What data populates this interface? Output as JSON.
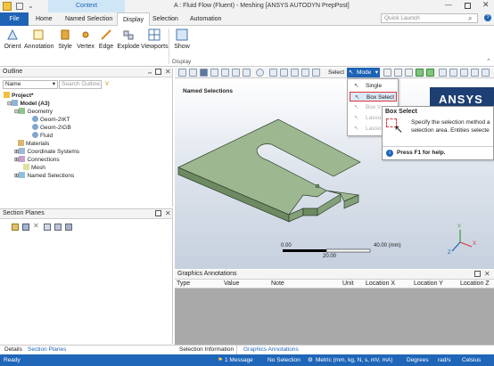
{
  "titlebar": {
    "context": "Context",
    "title": "A : Fluid Flow (Fluent) - Meshing [ANSYS AUTODYN PrepPost]"
  },
  "search": {
    "placeholder": "Quick Launch"
  },
  "tabs": [
    "File",
    "Home",
    "Named Selection",
    "Display",
    "Selection",
    "Automation"
  ],
  "ribbon": {
    "buttons": [
      "Orient",
      "Annotation",
      "Style",
      "Vertex",
      "Edge",
      "Explode",
      "Viewports",
      "Show"
    ],
    "group_label": "Display"
  },
  "outline": {
    "title": "Outline",
    "filter_label": "Name",
    "search_placeholder": "Search Outline",
    "items": [
      "Project*",
      "Model (A3)",
      "Geometry",
      "Geom-2\\KT",
      "Geom-2\\GB",
      "Fluid",
      "Materials",
      "Coordinate Systems",
      "Connections",
      "Mesh",
      "Named Selections"
    ]
  },
  "section_planes": {
    "title": "Section Planes"
  },
  "bottom_tabs_left": [
    "Details",
    "Section Planes"
  ],
  "graphics": {
    "toolbar_select": "Select",
    "toolbar_mode": "Mode",
    "viewport_title": "Named Selections",
    "logo": "ANSYS",
    "scale_labels": [
      "0.00",
      "40.00 (mm)",
      "20.00"
    ]
  },
  "mode_menu": {
    "items": [
      "Single Select",
      "Box Select",
      "Box Volume Select",
      "Lasso Select",
      "Lasso Volume Select"
    ],
    "visible_items": [
      "Single Select",
      "Box Select",
      "Box V",
      "Lasso",
      "Lasso"
    ]
  },
  "tooltip": {
    "title": "Box Select",
    "body": "Specify the selection method as a box drawn over the selection area. Entities selected",
    "body_visible": "Specify the selection method a selection area. Entities selecte",
    "help": "Press F1 for help."
  },
  "annotations": {
    "title": "Graphics Annotations",
    "columns": [
      "Type",
      "Value",
      "Note",
      "Unit",
      "Location X",
      "Location Y",
      "Location Z"
    ]
  },
  "bottom_tabs_right": [
    "Selection Information",
    "Graphics Annotations"
  ],
  "status": {
    "ready": "Ready",
    "messages": "1 Message",
    "selection": "No Selection",
    "units": "Metric (mm, kg, N, s, mV, mA)",
    "angle": "Degrees",
    "rate": "rad/s",
    "temp": "Celsius"
  },
  "colors": {
    "accent": "#1e63b5",
    "body": "#9db890",
    "highlight": "#d9363e"
  }
}
